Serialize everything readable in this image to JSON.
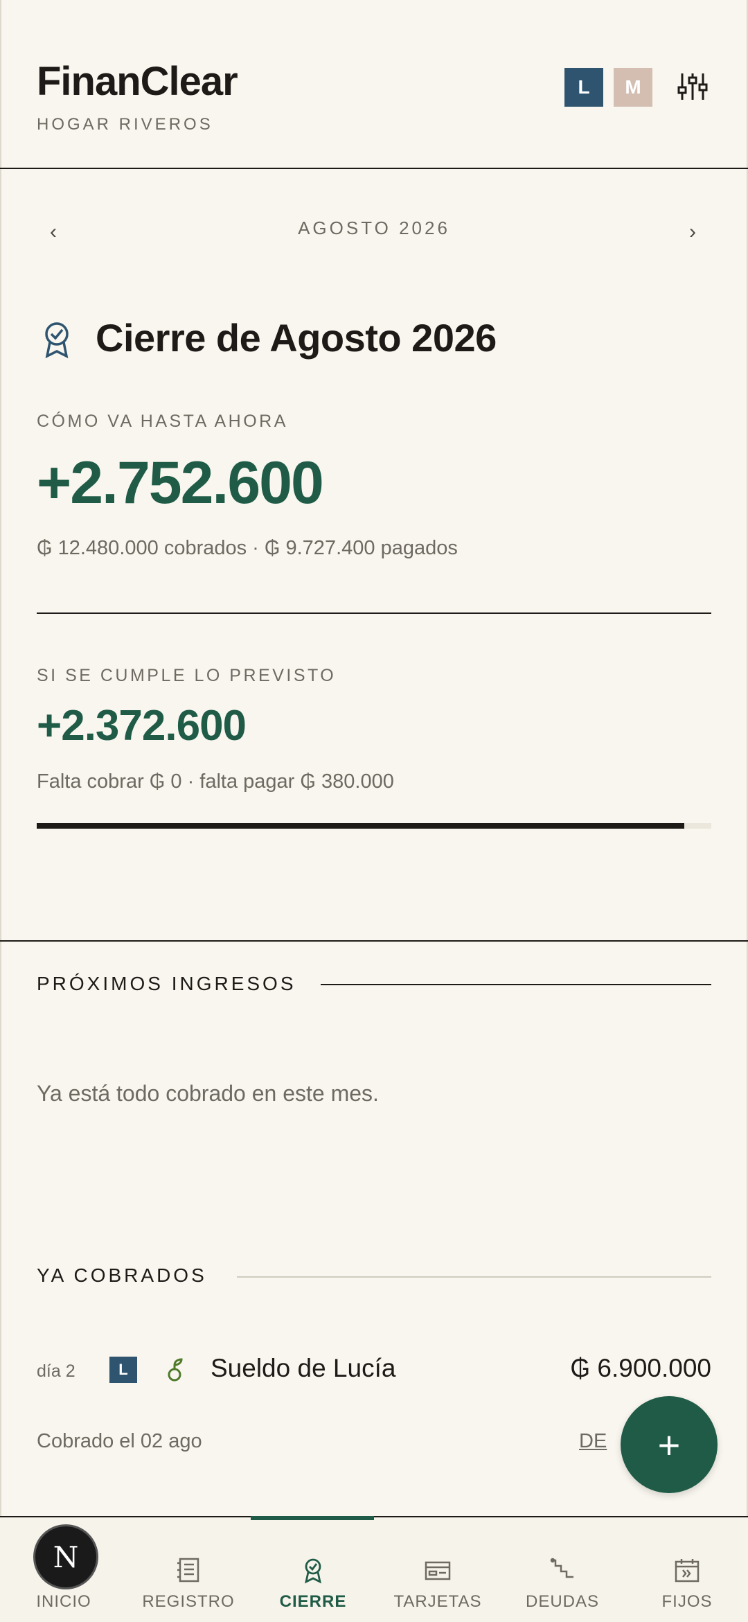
{
  "header": {
    "app_title": "FinanClear",
    "household": "HOGAR RIVEROS",
    "avatars": [
      "L",
      "M"
    ]
  },
  "month_nav": {
    "prev": "‹",
    "label": "AGOSTO 2026",
    "next": "›"
  },
  "cierre": {
    "title": "Cierre de Agosto 2026",
    "current": {
      "kicker": "CÓMO VA HASTA AHORA",
      "value": "+2.752.600",
      "detail": "₲ 12.480.000 cobrados · ₲ 9.727.400 pagados"
    },
    "forecast": {
      "kicker": "SI SE CUMPLE LO PREVISTO",
      "value": "+2.372.600",
      "detail": "Falta cobrar ₲ 0 · falta pagar ₲ 380.000",
      "progress": 0.96
    }
  },
  "upcoming_income": {
    "heading": "PRÓXIMOS INGRESOS",
    "empty": "Ya está todo cobrado en este mes."
  },
  "collected": {
    "heading": "YA COBRADOS",
    "items": [
      {
        "day": "día 2",
        "person": "L",
        "name": "Sueldo de Lucía",
        "amount": "₲ 6.900.000",
        "meta": "Cobrado el 02 ago",
        "action": "DE"
      }
    ]
  },
  "fab": {
    "label": "+"
  },
  "bottom_nav": {
    "items": [
      {
        "label": "INICIO",
        "icon": "home-icon"
      },
      {
        "label": "REGISTRO",
        "icon": "ledger-icon"
      },
      {
        "label": "CIERRE",
        "icon": "badge-icon"
      },
      {
        "label": "TARJETAS",
        "icon": "card-icon"
      },
      {
        "label": "DEUDAS",
        "icon": "stairs-icon"
      },
      {
        "label": "FIJOS",
        "icon": "calendar-icon"
      }
    ],
    "active": "CIERRE"
  },
  "dev_badge": "N",
  "colors": {
    "background": "#f8f6ee",
    "accent": "#1f5b47",
    "person_l": "#2e5470",
    "person_m": "#d3beb1"
  }
}
